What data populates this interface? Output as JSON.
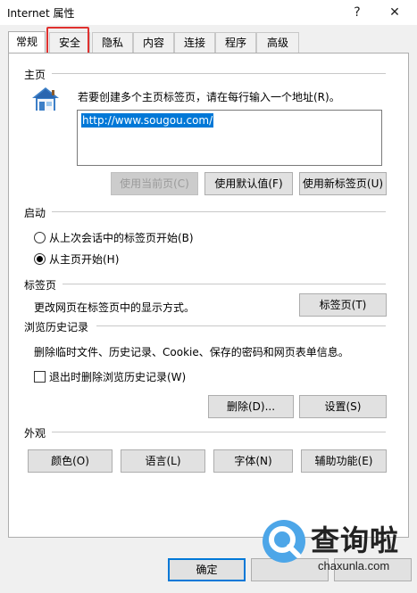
{
  "window": {
    "title": "Internet 属性",
    "help_label": "?",
    "close_label": "✕"
  },
  "tabs": [
    {
      "label": "常规",
      "active": true
    },
    {
      "label": "安全"
    },
    {
      "label": "隐私"
    },
    {
      "label": "内容"
    },
    {
      "label": "连接"
    },
    {
      "label": "程序"
    },
    {
      "label": "高级"
    }
  ],
  "home": {
    "heading": "主页",
    "instruction": "若要创建多个主页标签页，请在每行输入一个地址(R)。",
    "url": "http://www.sougou.com/",
    "btn_current": "使用当前页(C)",
    "btn_default": "使用默认值(F)",
    "btn_newtab": "使用新标签页(U)"
  },
  "startup": {
    "heading": "启动",
    "option_last_session": "从上次会话中的标签页开始(B)",
    "option_home": "从主页开始(H)",
    "selected": "option_home"
  },
  "tabs_section": {
    "heading": "标签页",
    "description": "更改网页在标签页中的显示方式。",
    "button": "标签页(T)"
  },
  "history": {
    "heading": "浏览历史记录",
    "description": "删除临时文件、历史记录、Cookie、保存的密码和网页表单信息。",
    "checkbox_label": "退出时删除浏览历史记录(W)",
    "checkbox_checked": false,
    "btn_delete": "删除(D)...",
    "btn_settings": "设置(S)"
  },
  "appearance": {
    "heading": "外观",
    "btn_colors": "颜色(O)",
    "btn_languages": "语言(L)",
    "btn_fonts": "字体(N)",
    "btn_accessibility": "辅助功能(E)"
  },
  "footer": {
    "ok": "确定"
  },
  "watermark": {
    "brand": "查询啦",
    "domain": "chaxunla.com"
  }
}
